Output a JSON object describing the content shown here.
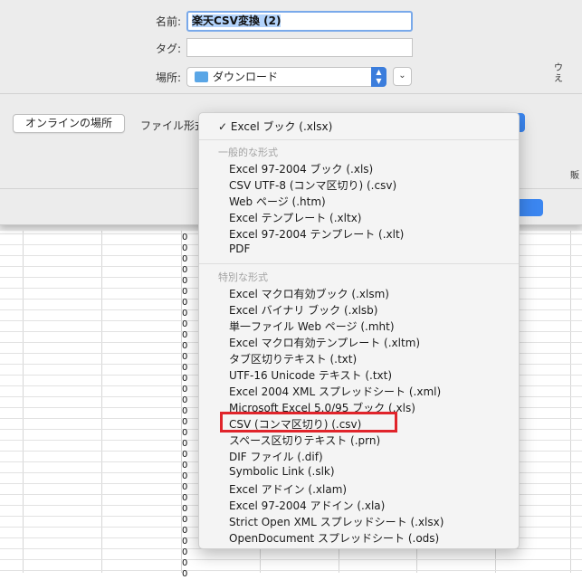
{
  "dialog": {
    "name_label": "名前:",
    "name_value": "楽天CSV変換 (2)",
    "tags_label": "タグ:",
    "tags_value": "",
    "location_label": "場所:",
    "location_value": "ダウンロード",
    "online_button": "オンラインの場所",
    "format_label": "ファイル形式",
    "side_fragment": "ウ え",
    "side_fragment2": "販"
  },
  "menu": {
    "selected": "Excel ブック (.xlsx)",
    "selected_check": "✓",
    "common_header": "一般的な形式",
    "common_items": [
      "Excel 97-2004 ブック (.xls)",
      "CSV UTF-8 (コンマ区切り) (.csv)",
      "Web ページ (.htm)",
      "Excel テンプレート (.xltx)",
      "Excel 97-2004 テンプレート (.xlt)",
      "PDF"
    ],
    "special_header": "特別な形式",
    "special_items": [
      "Excel マクロ有効ブック (.xlsm)",
      "Excel バイナリ ブック (.xlsb)",
      "単一ファイル Web ページ (.mht)",
      "Excel マクロ有効テンプレート (.xltm)",
      "タブ区切りテキスト (.txt)",
      "UTF-16 Unicode テキスト (.txt)",
      "Excel 2004 XML スプレッドシート (.xml)",
      "Microsoft Excel 5.0/95 ブック (.xls)",
      "CSV (コンマ区切り) (.csv)",
      "スペース区切りテキスト (.prn)",
      "DIF ファイル (.dif)",
      "Symbolic Link (.slk)",
      "Excel アドイン (.xlam)",
      "Excel 97-2004 アドイン (.xla)",
      "Strict Open XML スプレッドシート (.xlsx)",
      "OpenDocument スプレッドシート (.ods)"
    ]
  },
  "sheet": {
    "cell_zero": "0"
  }
}
